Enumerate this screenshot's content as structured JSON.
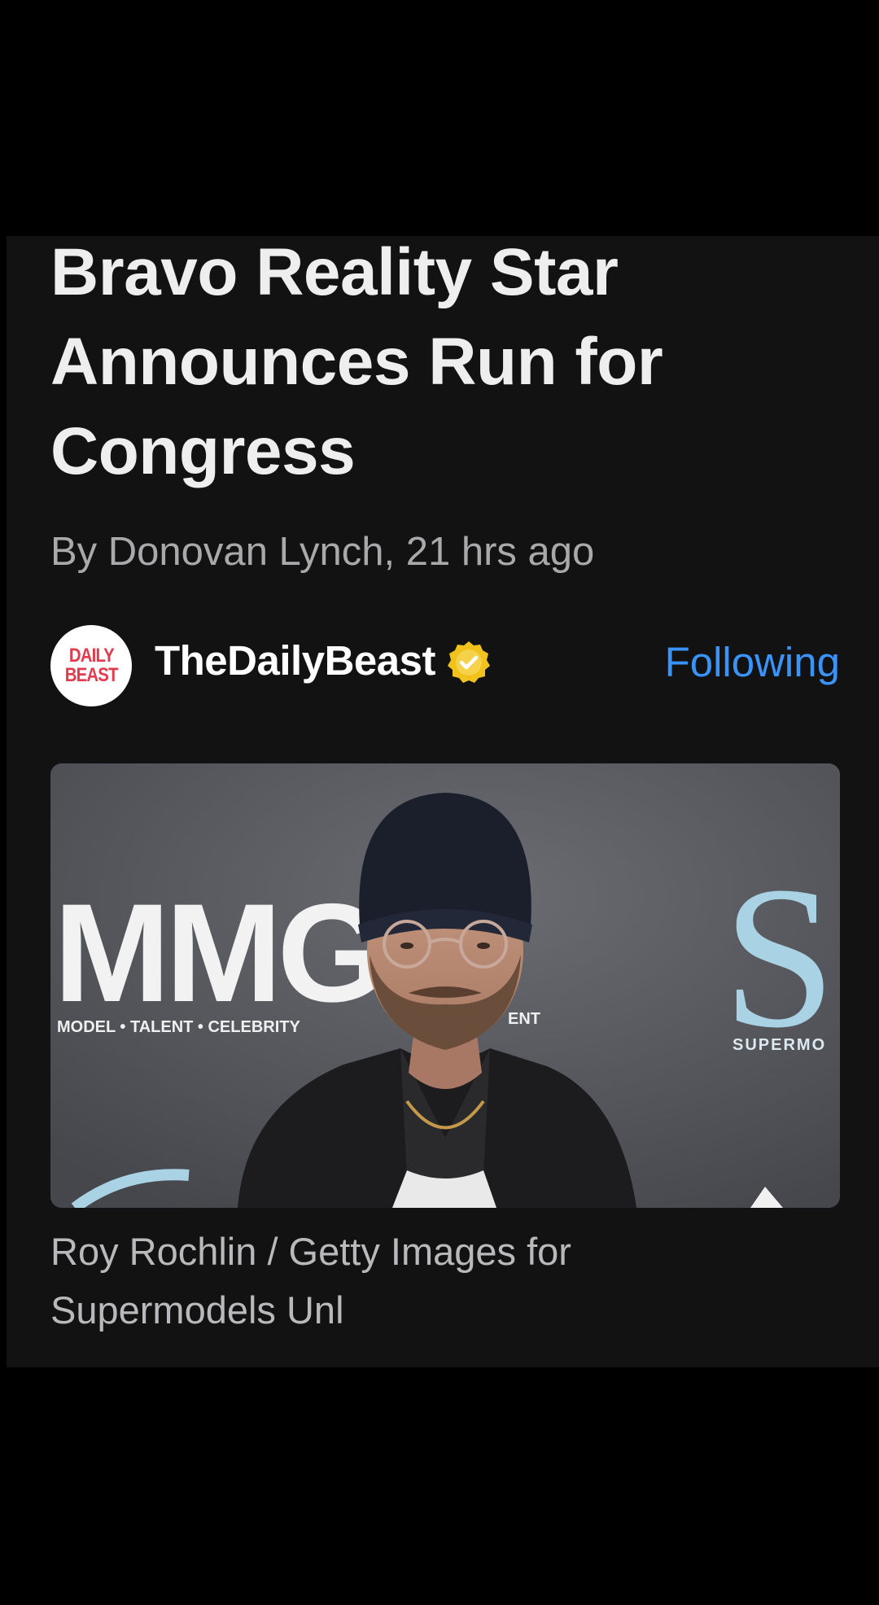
{
  "article": {
    "headline": "Bravo Reality Star Announces Run for Congress",
    "byline_author": "By Donovan Lynch,",
    "byline_time": "21 hrs ago"
  },
  "publisher": {
    "logo_line1": "DAILY",
    "logo_line2": "BEAST",
    "name": "TheDailyBeast",
    "verified_icon": "verified-badge-icon",
    "follow_label": "Following"
  },
  "image": {
    "backdrop_logo": "MMG",
    "backdrop_tagline": "MODEL • TALENT • CELEBRITY",
    "backdrop_tagline_suffix": "ENT",
    "backdrop_right_letter": "S",
    "backdrop_right_text": "SUPERMO",
    "caption": "Roy Rochlin / Getty Images for Supermodels Unl"
  },
  "colors": {
    "background": "#000000",
    "card": "#121213",
    "link_blue": "#3a93f7",
    "verified_gold": "#f1c21b",
    "brand_red": "#e43a4e"
  }
}
